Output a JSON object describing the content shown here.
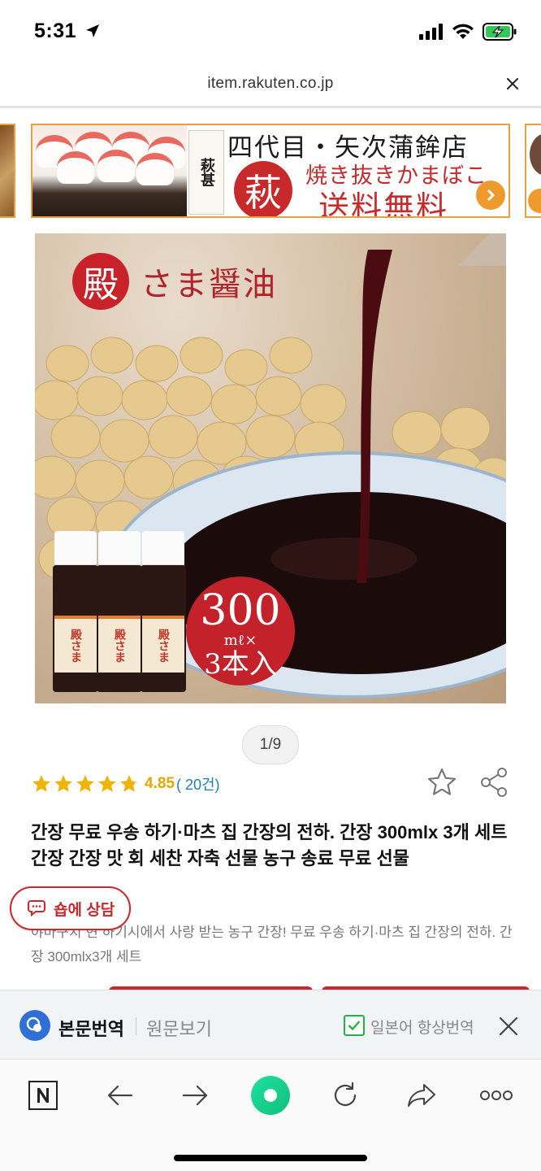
{
  "status_bar": {
    "time": "5:31",
    "icons": [
      "location-arrow-icon",
      "cellular-signal-icon",
      "wifi-icon",
      "battery-charging-icon"
    ]
  },
  "browser": {
    "url": "item.rakuten.co.jp"
  },
  "banner": {
    "shop_name": "四代目・矢次蒲鉾店",
    "pack_text": "萩甚",
    "hagi_char": "萩",
    "line1": "焼き抜きかまぼこ",
    "line2": "送料無料"
  },
  "product_image": {
    "tag_char": "殿",
    "tag_text": "さま醤油",
    "volume": "300",
    "unit": "mℓ×",
    "count": "3本入",
    "bottle_label": "殿さま"
  },
  "pager": {
    "text": "1/9"
  },
  "rating": {
    "stars": 4.85,
    "score": "4.85",
    "count": "( 20건)"
  },
  "product": {
    "title": "간장 무료 우송 하기·마츠 집 간장의 전하. 간장 300mlx 3개 세트 간장 간장 맛 회 세찬 자축 선물 농구 송료 무료 선물",
    "description": "야마구치 현 하기시에서 사랑 받는 농구 간장! 무료 우송 하기·마츠 집 간장의 전하. 간장 300mlx3개 세트"
  },
  "chat_button": {
    "label": "숍에 상담"
  },
  "translate_bar": {
    "active_label": "본문번역",
    "original_label": "원문보기",
    "always_label": "일본어 항상번역",
    "always_checked": true
  },
  "toolbar": {
    "items": [
      "naver-n-icon",
      "back-arrow-icon",
      "forward-arrow-icon",
      "green-dot-icon",
      "refresh-icon",
      "share-arrow-icon",
      "more-icon"
    ]
  },
  "colors": {
    "accent_red": "#c9282d",
    "star_gold": "#f0b400",
    "link_blue": "#1a7fc2",
    "check_green": "#21b24b",
    "naver_green": "#13d38e"
  }
}
